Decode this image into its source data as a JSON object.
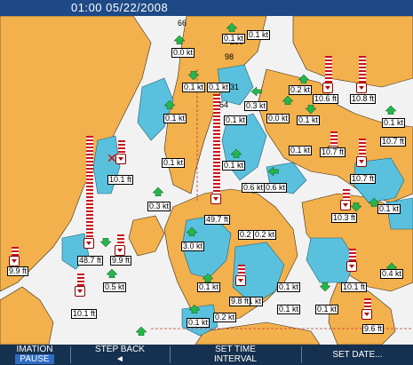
{
  "header": {
    "datetime": "01:00 05/22/2008"
  },
  "map_labels": [
    "0.0 kt",
    "0.1 kt",
    "0.1 kt",
    "0.1 kt",
    "0.1 kt",
    "0.0 kt",
    "0.1 kt",
    "0.2 kt",
    "0.1 kt",
    "0.3 kt",
    "0.1 kt",
    "0.1 kt",
    "0.1 kt",
    "0.1 kt",
    "0.6 kt",
    "0.6 kt",
    "0.3 kt",
    "0.1 kt",
    "0.1 kt",
    "0.2 kt",
    "0.2 kt",
    "3.0 kt",
    "0.5 kt",
    "0.1 kt",
    "0.1 kt",
    "0.1 kt",
    "0.1 kt",
    "0.4 kt",
    "0.1 kt",
    "0.2 kt",
    "0.1 kt",
    "10.6 ft",
    "10.8 ft",
    "10.7 ft",
    "10.1 ft",
    "10.7 ft",
    "10.7 ft",
    "10.3 ft",
    "49.7 ft",
    "48.7 ft",
    "9.9 ft",
    "9.9 ft",
    "10.1 ft",
    "9.8 ft",
    "10.1 ft",
    "9.6 ft"
  ],
  "depth_soundings": [
    "66",
    "230",
    "98",
    "31",
    "54"
  ],
  "softkeys": {
    "animation": "IMATION",
    "pause": "PAUSE",
    "step_back": "STEP BACK",
    "step_back_arrow": "◄",
    "set_time": "SET TIME",
    "interval": "INTERVAL",
    "set_date": "SET DATE..."
  },
  "colors": {
    "land": "#f2b14d",
    "shallow_water": "#59c1dd",
    "deep_water": "#f2f2f2",
    "current_arrow": "#25b64b",
    "tide_bar": "#c8111b",
    "top_bar": "#1d4a86",
    "bottom_bar": "#16314f"
  }
}
